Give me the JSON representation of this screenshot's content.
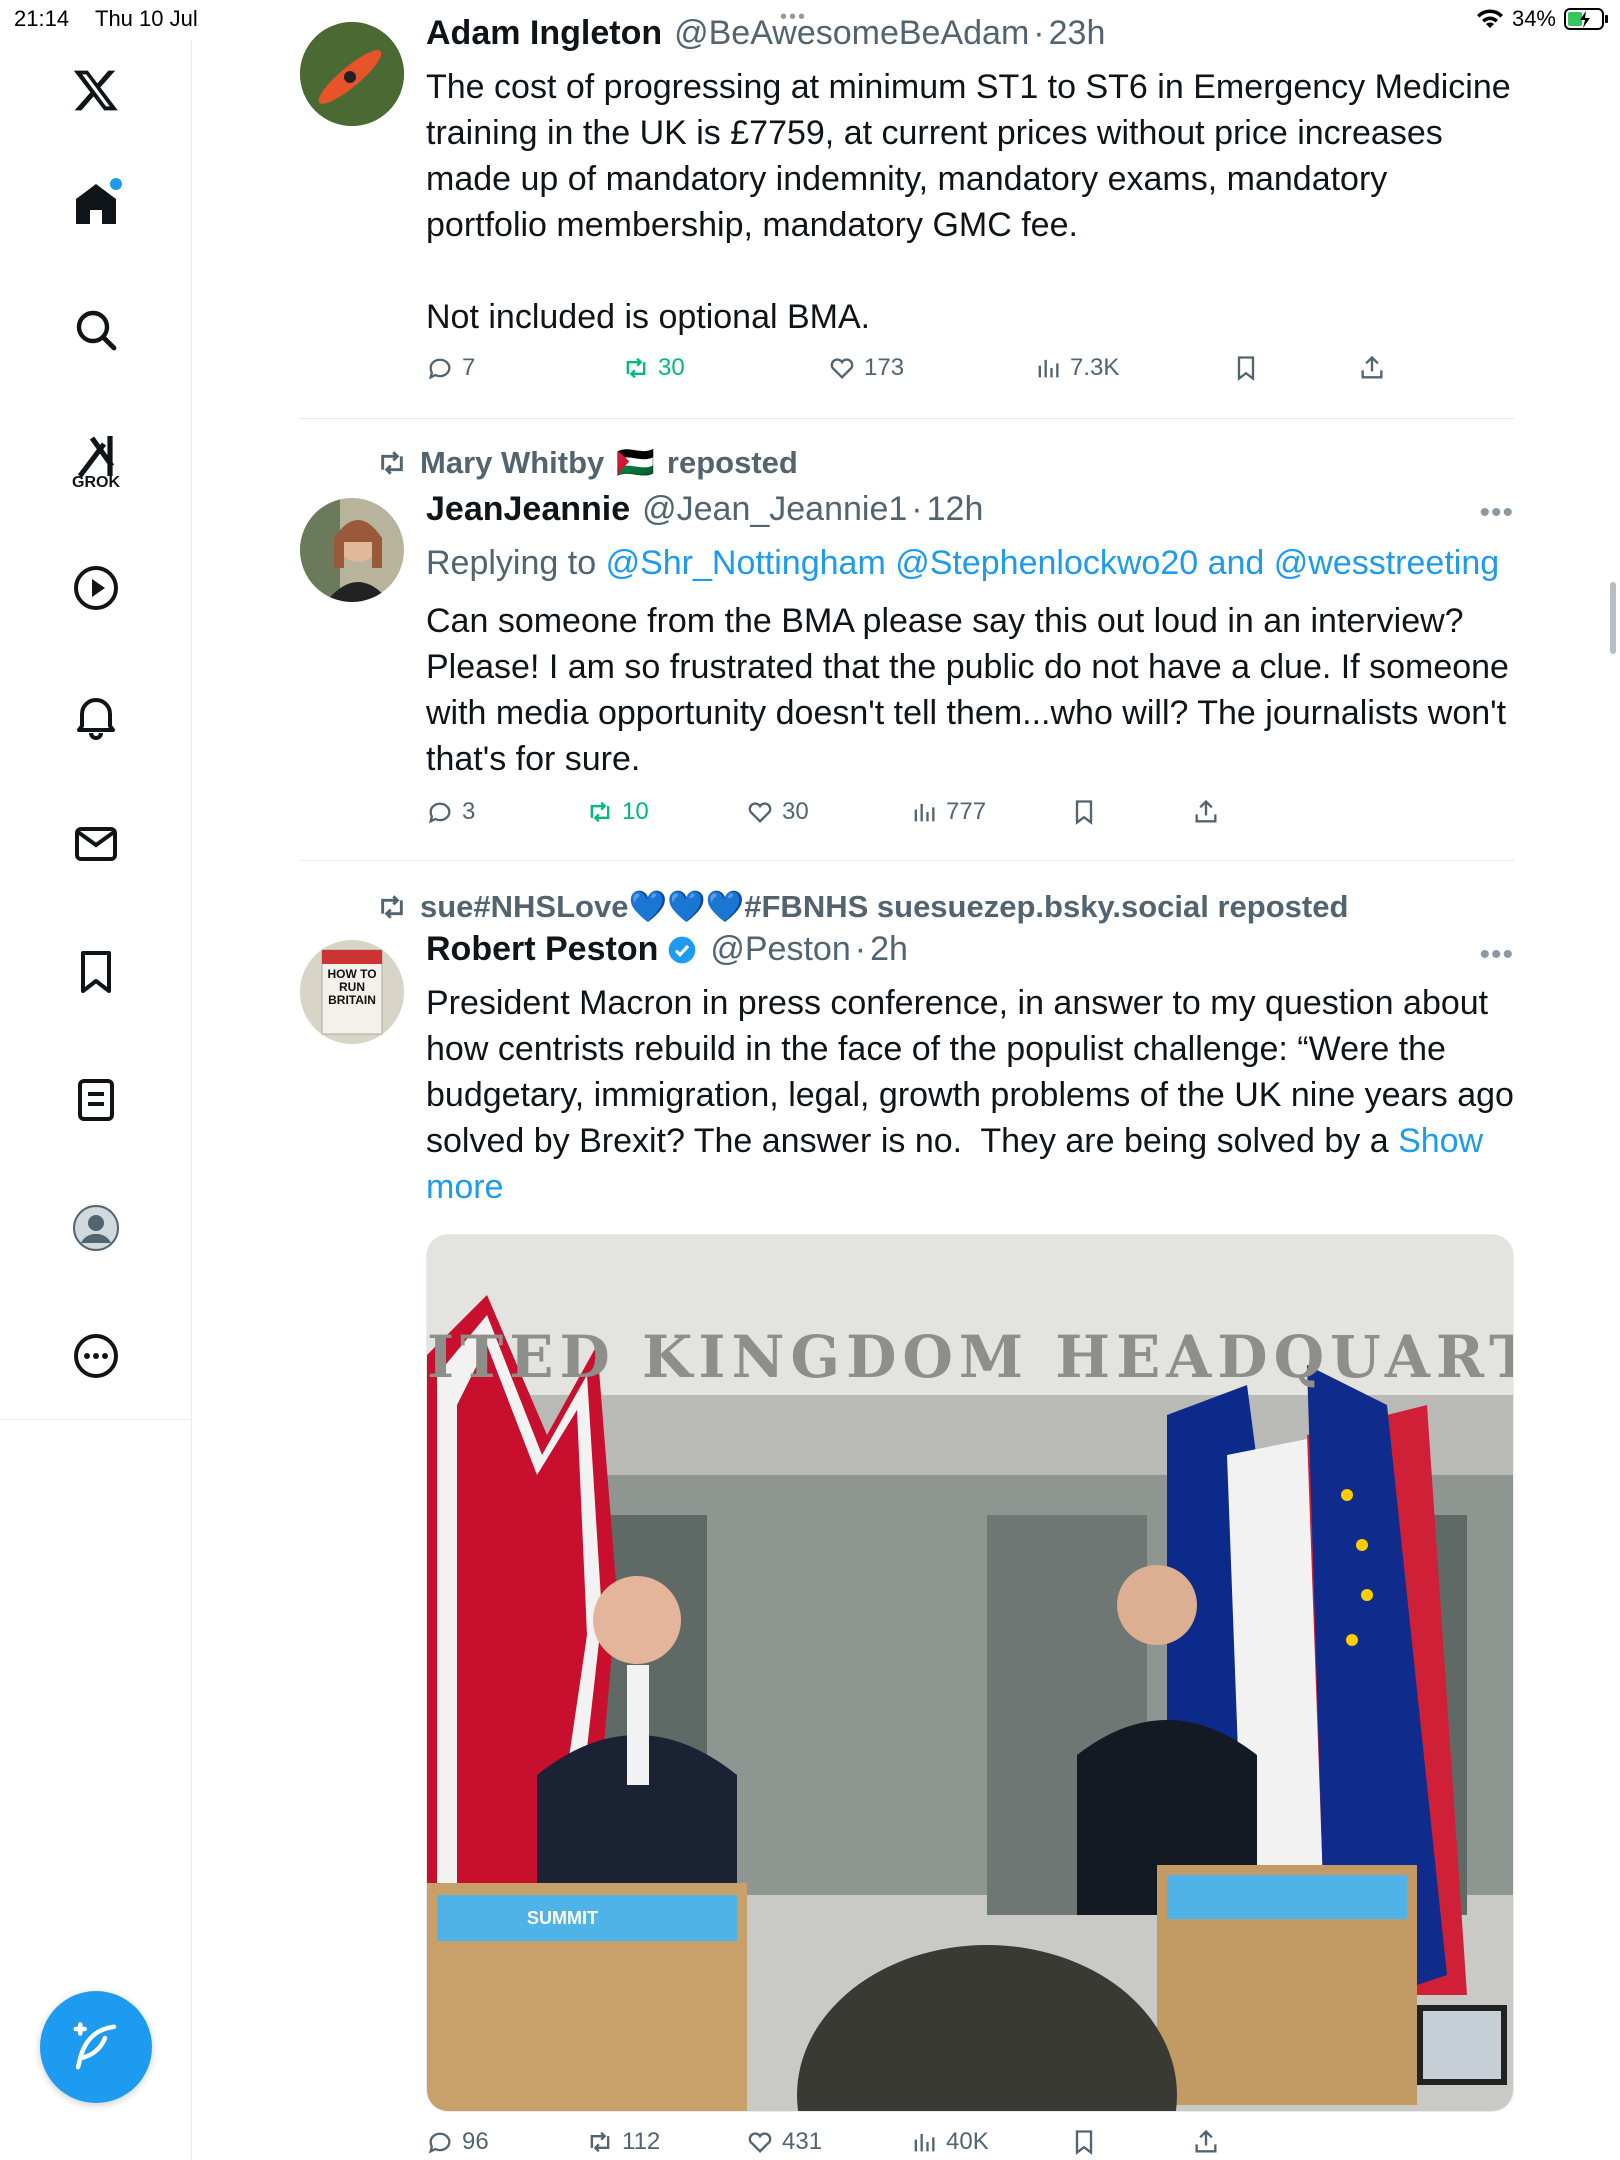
{
  "status": {
    "time": "21:14",
    "date": "Thu 10 Jul",
    "battery": "34%",
    "dots": "•••"
  },
  "sidebar": {
    "grok_label": "GROK"
  },
  "tweets": [
    {
      "name": "Adam Ingleton",
      "handle": "@BeAwesomeBeAdam",
      "time": "23h",
      "text": "The cost of progressing at minimum ST1 to ST6 in Emergency Medicine training in the UK is £7759, at current prices without price increases made up of mandatory indemnity, mandatory exams, mandatory portfolio membership, mandatory GMC fee.\n\nNot included is optional BMA.",
      "replies": "7",
      "reposts": "30",
      "likes": "173",
      "views": "7.3K"
    },
    {
      "reposted_by": "Mary Whitby",
      "reposted_flag": "🇵🇸",
      "reposted_suffix": "reposted",
      "name": "JeanJeannie",
      "handle": "@Jean_Jeannie1",
      "time": "12h",
      "replying_prefix": "Replying to",
      "replying_handles": "@Shr_Nottingham @Stephenlockwo20 and @wesstreeting",
      "text": "Can someone from the BMA please say this out loud in an interview? Please! I am so frustrated that the public do not have a clue. If someone with media opportunity doesn't tell them...who will? The journalists won't that's for sure.",
      "replies": "3",
      "reposts": "10",
      "likes": "30",
      "views": "777"
    },
    {
      "reposted_by": "sue#NHSLove💙💙💙#FBNHS suesuezep.bsky.social reposted",
      "name": "Robert Peston",
      "handle": "@Peston",
      "time": "2h",
      "text": "President Macron in press conference, in answer to my question about how centrists rebuild in the face of the populist challenge: “Were the budgetary, immigration, legal, growth problems of the UK nine years ago solved by Brexit? The answer is no.  They are being solved by a ",
      "show_more": "Show more",
      "avatar_text": "HOW TO RUN BRITAIN",
      "photo_sign": "ITED KINGDOM HEADQUARTI",
      "podium_text": "SUMMIT",
      "replies": "96",
      "reposts": "112",
      "likes": "431",
      "views": "40K"
    }
  ],
  "colors": {
    "accent": "#1d9bf0",
    "repost_green": "#00ba7c",
    "muted": "#536471"
  }
}
